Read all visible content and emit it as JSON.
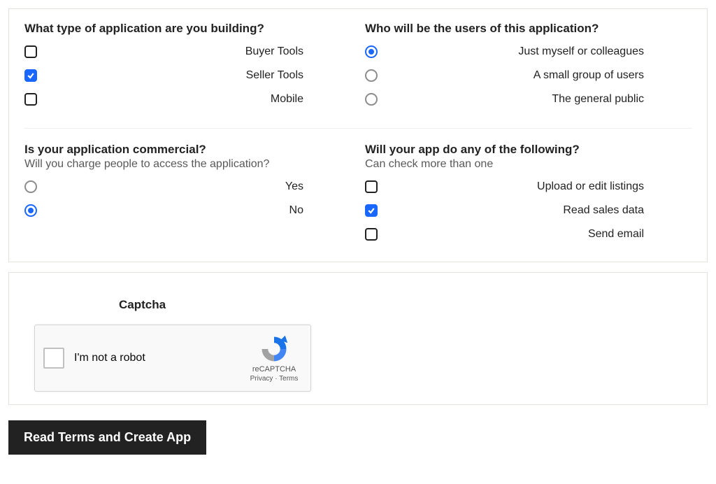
{
  "section1": {
    "q1": {
      "title": "What type of application are you building?",
      "options": [
        {
          "label": "Buyer Tools",
          "checked": false
        },
        {
          "label": "Seller Tools",
          "checked": true
        },
        {
          "label": "Mobile",
          "checked": false
        }
      ]
    },
    "q2": {
      "title": "Who will be the users of this application?",
      "options": [
        {
          "label": "Just myself or colleagues",
          "checked": true
        },
        {
          "label": "A small group of users",
          "checked": false
        },
        {
          "label": "The general public",
          "checked": false
        }
      ]
    },
    "q3": {
      "title": "Is your application commercial?",
      "subtitle": "Will you charge people to access the application?",
      "options": [
        {
          "label": "Yes",
          "checked": false
        },
        {
          "label": "No",
          "checked": true
        }
      ]
    },
    "q4": {
      "title": "Will your app do any of the following?",
      "subtitle": "Can check more than one",
      "options": [
        {
          "label": "Upload or edit listings",
          "checked": false
        },
        {
          "label": "Read sales data",
          "checked": true
        },
        {
          "label": "Send email",
          "checked": false
        }
      ]
    }
  },
  "captcha": {
    "heading": "Captcha",
    "checkbox_label": "I'm not a robot",
    "brand": "reCAPTCHA",
    "privacy": "Privacy",
    "terms": "Terms"
  },
  "submit_label": "Read Terms and Create App"
}
